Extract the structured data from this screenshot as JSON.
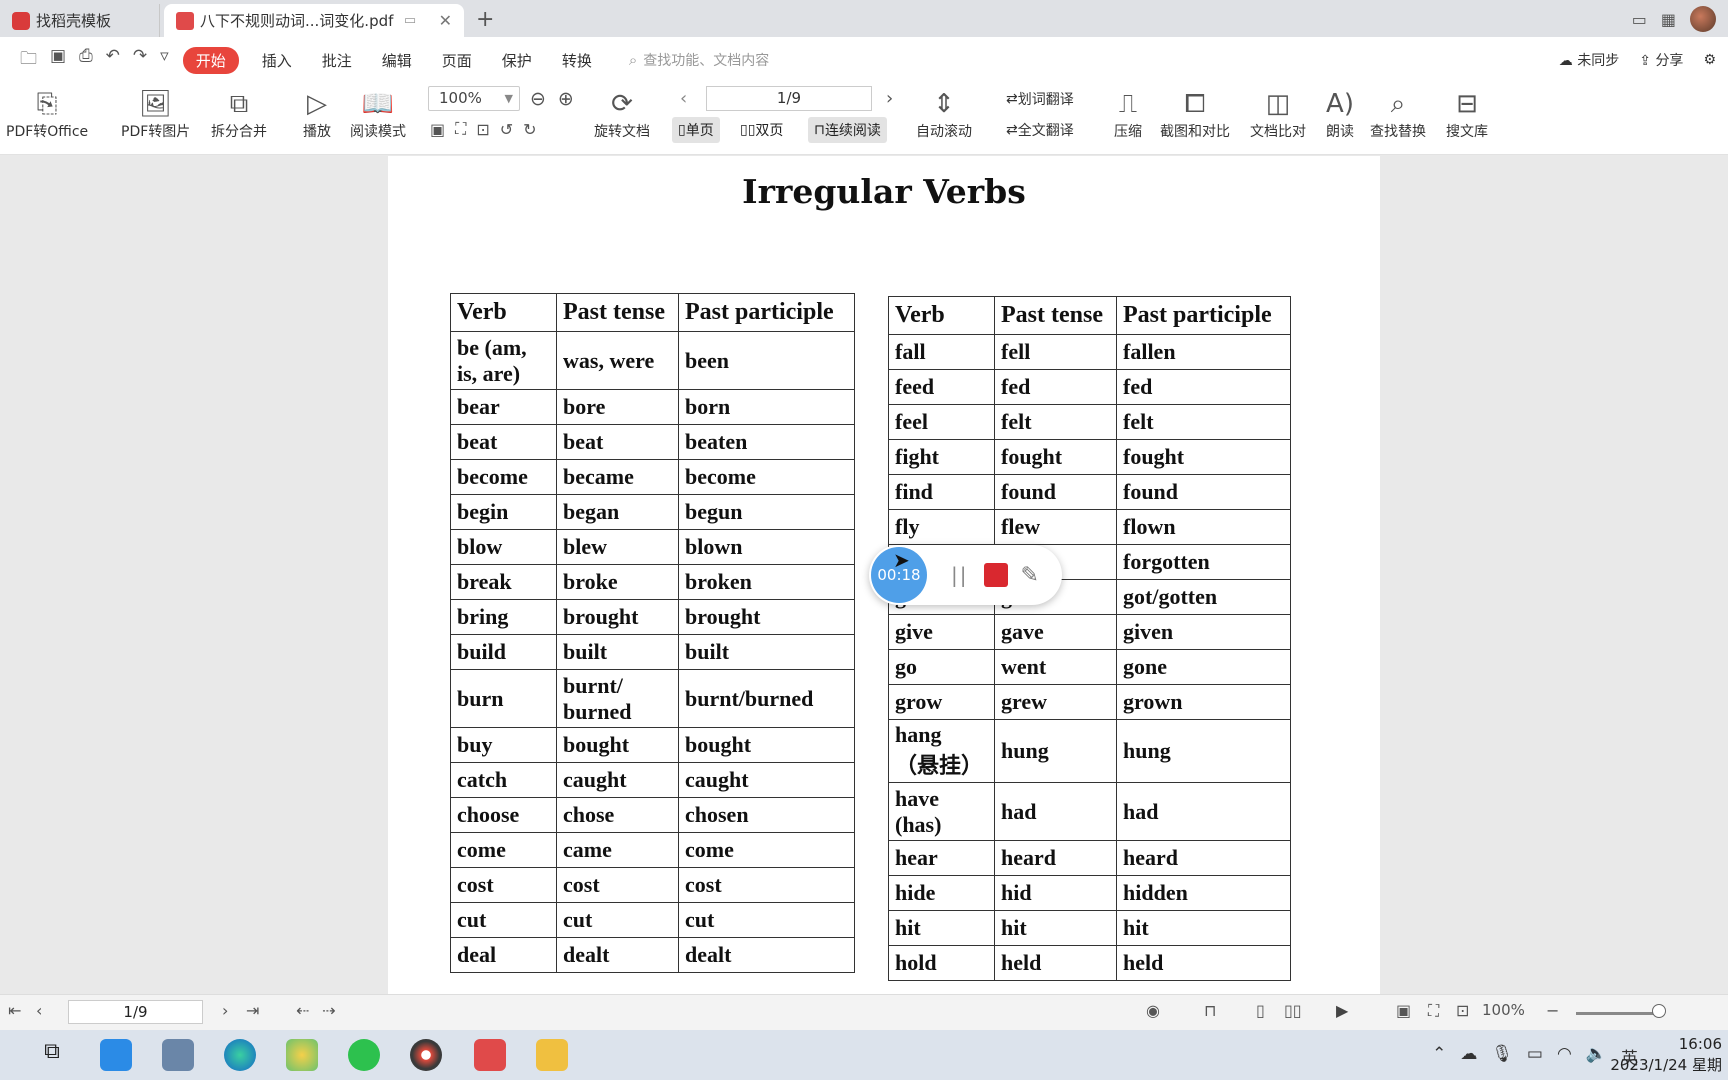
{
  "tabs": {
    "first": "找稻壳模板",
    "active": "八下不规则动词...词变化.pdf"
  },
  "menu": {
    "items": [
      "开始",
      "插入",
      "批注",
      "编辑",
      "页面",
      "保护",
      "转换"
    ],
    "search_placeholder": "查找功能、文档内容",
    "sync": "未同步",
    "share": "分享"
  },
  "toolbar": {
    "pdf_to_office": "PDF转Office",
    "pdf_to_image": "PDF转图片",
    "split_merge": "拆分合并",
    "play": "播放",
    "read_mode": "阅读模式",
    "zoom": "100%",
    "rotate_doc": "旋转文档",
    "page": "1/9",
    "single_page": "单页",
    "double_page": "双页",
    "continuous": "连续阅读",
    "auto_scroll": "自动滚动",
    "word_translate": "划词翻译",
    "full_translate": "全文翻译",
    "compress": "压缩",
    "screenshot_compare": "截图和对比",
    "doc_compare": "文档比对",
    "read_aloud": "朗读",
    "find_replace": "查找替换",
    "search_lib": "搜文库"
  },
  "document": {
    "title": "Irregular Verbs",
    "headers": [
      "Verb",
      "Past tense",
      "Past participle"
    ],
    "left_rows": [
      [
        "be (am, is, are)",
        "was, were",
        "been"
      ],
      [
        "bear",
        "bore",
        "born"
      ],
      [
        "beat",
        "beat",
        "beaten"
      ],
      [
        "become",
        "became",
        "become"
      ],
      [
        "begin",
        "began",
        "begun"
      ],
      [
        "blow",
        "blew",
        "blown"
      ],
      [
        "break",
        "broke",
        "broken"
      ],
      [
        "bring",
        "brought",
        "brought"
      ],
      [
        "build",
        "built",
        "built"
      ],
      [
        "burn",
        "burnt/ burned",
        "burnt/burned"
      ],
      [
        "buy",
        "bought",
        "bought"
      ],
      [
        "catch",
        "caught",
        "caught"
      ],
      [
        "choose",
        "chose",
        "chosen"
      ],
      [
        "come",
        "came",
        "come"
      ],
      [
        "cost",
        "cost",
        "cost"
      ],
      [
        "cut",
        "cut",
        "cut"
      ],
      [
        "deal",
        "dealt",
        "dealt"
      ]
    ],
    "right_rows": [
      [
        "fall",
        "fell",
        "fallen"
      ],
      [
        "feed",
        "fed",
        "fed"
      ],
      [
        "feel",
        "felt",
        "felt"
      ],
      [
        "fight",
        "fought",
        "fought"
      ],
      [
        "find",
        "found",
        "found"
      ],
      [
        "fly",
        "flew",
        "flown"
      ],
      [
        "",
        "",
        "forgotten"
      ],
      [
        "got",
        "got",
        "got/gotten"
      ],
      [
        "give",
        "gave",
        "given"
      ],
      [
        "go",
        "went",
        "gone"
      ],
      [
        "grow",
        "grew",
        "grown"
      ],
      [
        "hang （悬挂）",
        "hung",
        "hung"
      ],
      [
        "have (has)",
        "had",
        "had"
      ],
      [
        "hear",
        "heard",
        "heard"
      ],
      [
        "hide",
        "hid",
        "hidden"
      ],
      [
        "hit",
        "hit",
        "hit"
      ],
      [
        "hold",
        "held",
        "held"
      ]
    ]
  },
  "recorder": {
    "time": "00:18"
  },
  "statusbar": {
    "page": "1/9",
    "zoom": "100%"
  },
  "taskbar": {
    "ime": "英",
    "time": "16:06",
    "date": "2023/1/24 星期"
  }
}
